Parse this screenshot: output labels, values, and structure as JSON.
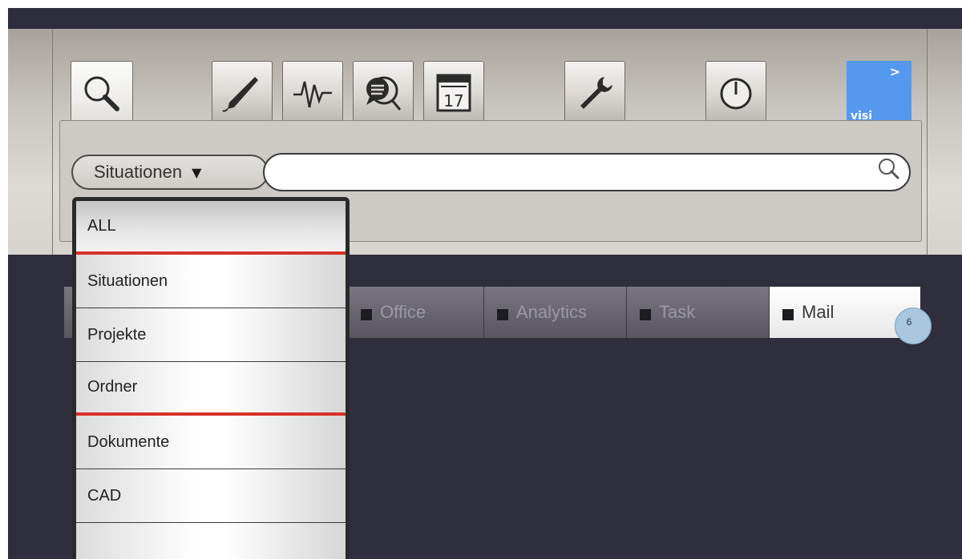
{
  "toolbar": {
    "icons": [
      "search-icon",
      "pen-icon",
      "activity-icon",
      "chat-search-icon",
      "calendar-icon",
      "wrench-icon",
      "power-icon"
    ],
    "calendar_day": "17",
    "visi": {
      "arrow": ">",
      "label": "visi",
      "color": "#5599ee"
    }
  },
  "search": {
    "scope_label": "Situationen",
    "scope_caret": "▼",
    "query": "",
    "placeholder": ""
  },
  "dropdown": {
    "items": [
      {
        "label": "ALL"
      },
      {
        "label": "Situationen"
      },
      {
        "label": "Projekte"
      },
      {
        "label": "Ordner"
      },
      {
        "label": "Dokumente"
      },
      {
        "label": "CAD"
      },
      {
        "label": ""
      }
    ]
  },
  "tabs": [
    {
      "label": "Office",
      "active": false
    },
    {
      "label": "Analytics",
      "active": false
    },
    {
      "label": "Task",
      "active": false
    },
    {
      "label": "Mail",
      "active": true,
      "badge": "6"
    }
  ],
  "colors": {
    "background": "#2e2e3c",
    "accent_blue": "#5599ee",
    "separator_red": "#d93127"
  }
}
